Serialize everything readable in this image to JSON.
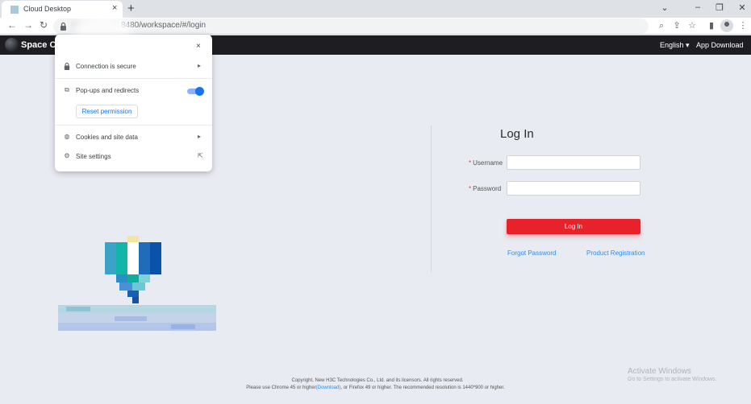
{
  "browser": {
    "tab_title": "Cloud Desktop",
    "tab_close": "×",
    "new_tab": "+",
    "url": "8480/workspace/#/login",
    "window_controls": [
      "⌄",
      "–",
      "❐",
      "✕"
    ]
  },
  "app_header": {
    "name": "Space Co",
    "language": "English ▾",
    "download": "App Download"
  },
  "site_info_popup": {
    "close": "×",
    "connection": "Connection is secure",
    "popups": "Pop-ups and redirects",
    "popups_enabled": true,
    "reset": "Reset permission",
    "cookies": "Cookies and site data",
    "site_settings": "Site settings",
    "icons": [
      "lock-icon",
      "external-link-icon",
      "cookie-icon",
      "gear-icon"
    ]
  },
  "login": {
    "title": "Log In",
    "username_label": "Username",
    "password_label": "Password",
    "required_mark": "*",
    "submit": "Log In",
    "forgot": "Forgot Password",
    "register": "Product Registration"
  },
  "footer": {
    "copyright": "Copyright, New H3C Technologies Co., Ltd. and its licensors. All rights reserved.",
    "req_prefix": "Please use Chrome 45 or higher",
    "req_download": "(Download)",
    "req_suffix": ", or Firefox 49 or higher. The recommended resolution is 1440*900 or higher."
  },
  "watermark": {
    "line1": "Activate Windows",
    "line2": "Go to Settings to activate Windows."
  },
  "colors": {
    "accent_red": "#e8222b",
    "link_blue": "#2d8cf0",
    "header_bg": "#1e1e22",
    "page_bg": "#e9ebf2"
  }
}
